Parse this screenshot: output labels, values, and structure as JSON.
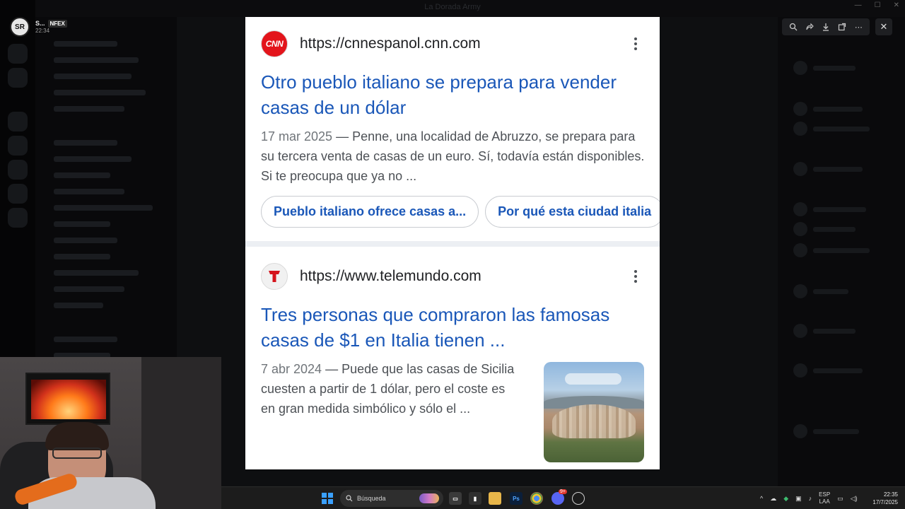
{
  "window": {
    "title": "La Dorada Army"
  },
  "stream": {
    "name": "S...",
    "tag": "NFEX",
    "time": "22:34",
    "avatar_text": "SR"
  },
  "viewer_toolbar": {
    "buttons": [
      "zoom-in",
      "share",
      "download",
      "open-external",
      "more"
    ],
    "close_label": "✕"
  },
  "results": [
    {
      "site_url": "https://cnnespanol.cnn.com",
      "favicon_text": "CNN",
      "title": "Otro pueblo italiano se prepara para vender casas de un dólar",
      "date": "17 mar 2025",
      "snippet": "— Penne, una localidad de Abruzzo, se prepara para su tercera venta de casas de un euro. Sí, todavía están disponibles. Si te preocupa que ya no ...",
      "chips": [
        "Pueblo italiano ofrece casas a...",
        "Por qué esta ciudad italia"
      ]
    },
    {
      "site_url": "https://www.telemundo.com",
      "favicon_text": "T",
      "title": "Tres personas que compraron las famosas casas de $1 en Italia tienen ...",
      "date": "7 abr 2024",
      "snippet": "— Puede que las casas de Sicilia cuesten a partir de 1 dólar, pero el coste es en gran medida simbólico y sólo el ..."
    }
  ],
  "taskbar": {
    "search_placeholder": "Búsqueda",
    "lang_top": "ESP",
    "lang_bottom": "LAA",
    "clock_time": "22:35",
    "clock_date": "17/7/2025",
    "discord_badge": "9+"
  },
  "colors": {
    "link": "#1a57b8",
    "cnn_red": "#e3141b",
    "telemundo_red": "#d5141c"
  }
}
